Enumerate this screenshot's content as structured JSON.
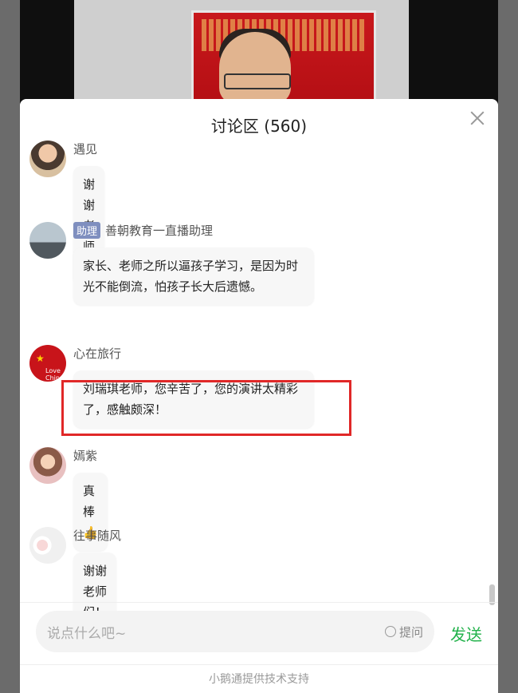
{
  "discussion": {
    "title": "讨论区 (560)"
  },
  "messages": [
    {
      "name": "遇见",
      "text": "谢谢老师们"
    },
    {
      "tag": "助理",
      "name": "善朝教育一直播助理",
      "text": "家长、老师之所以逼孩子学习，是因为时光不能倒流，怕孩子长大后遗憾。"
    },
    {
      "name": "心在旅行",
      "text": "刘瑞琪老师，您辛苦了，您的演讲太精彩了，感触颇深！",
      "avatar_text": "Love China"
    },
    {
      "name": "嫣紫",
      "text": "真棒👍"
    },
    {
      "name": "往事随风",
      "text": "谢谢老师们！"
    }
  ],
  "input": {
    "placeholder": "说点什么吧~",
    "ask_label": "提问",
    "send_label": "发送"
  },
  "footer": "小鹅通提供技术支持",
  "colors": {
    "send": "#21b24a",
    "highlight": "#e02828",
    "tag_bg": "#7f8fbf"
  }
}
